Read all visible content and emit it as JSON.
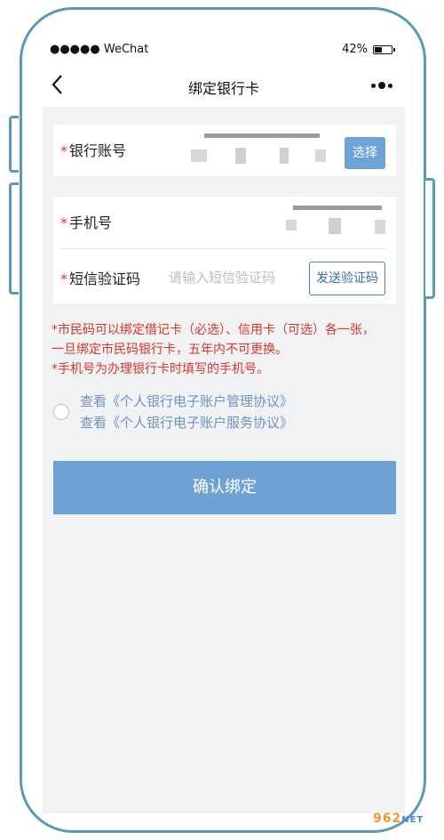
{
  "status_bar": {
    "carrier": "●●●●● WeChat",
    "battery_percent_text": "42%",
    "battery_level": 0.42
  },
  "nav": {
    "title": "绑定银行卡"
  },
  "form": {
    "bank_account_label": "银行账号",
    "select_button": "选择",
    "phone_label": "手机号",
    "sms_label": "短信验证码",
    "sms_placeholder": "请输入短信验证码",
    "send_sms_button": "发送验证码",
    "required_mark": "*"
  },
  "notes": [
    "*市民码可以绑定借记卡（必选）、信用卡（可选）各一张，",
    "一旦绑定市民码银行卡，五年内不可更换。",
    "*手机号为办理银行卡时填写的手机号。"
  ],
  "agreement": {
    "link1": "查看《个人银行电子账户管理协议》",
    "link2": "查看《个人银行电子账户服务协议》"
  },
  "confirm_button": "确认绑定",
  "watermark": {
    "brand": "962",
    "suffix": "NET"
  },
  "colors": {
    "frame": "#5a9bb3",
    "accent_button": "#6fa2d4",
    "warning_text": "#d9362b",
    "link_text": "#6f93c2"
  }
}
